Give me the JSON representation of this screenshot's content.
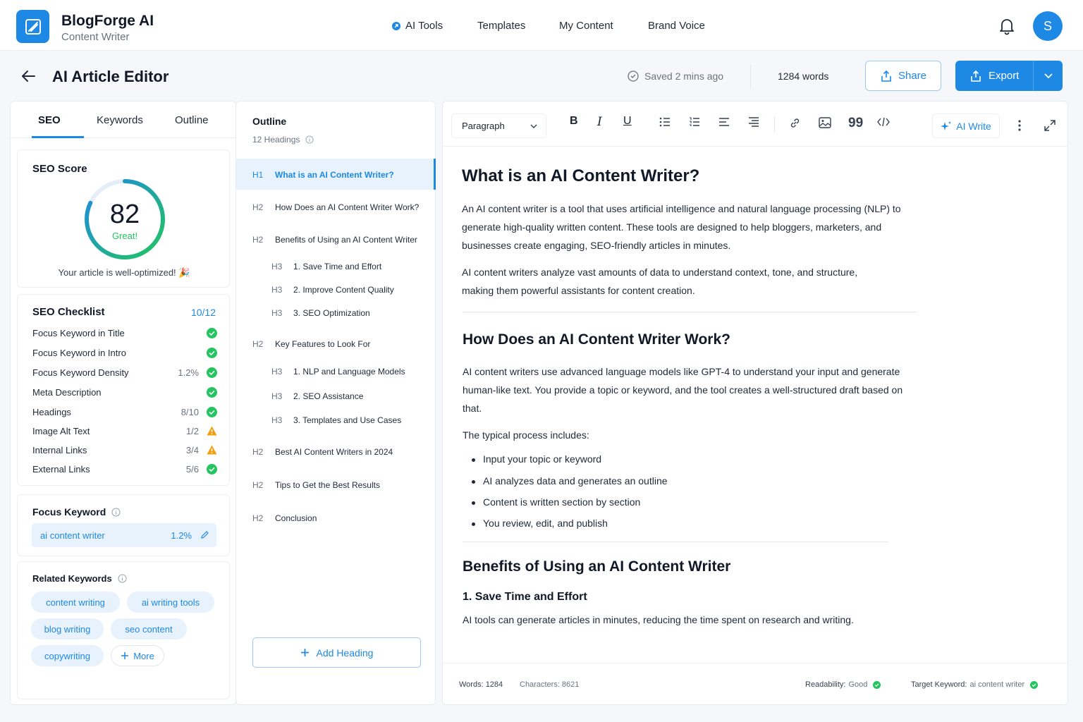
{
  "header": {
    "brand_name": "BlogForge AI",
    "brand_sub": "Content Writer",
    "nav": [
      "AI Tools",
      "Templates",
      "My Content",
      "Brand Voice"
    ],
    "avatar_initial": "S"
  },
  "page": {
    "title": "AI Article Editor",
    "saved": "Saved 2 mins ago",
    "words": "1284 words",
    "share": "Share",
    "export": "Export"
  },
  "left": {
    "tabs": [
      "SEO",
      "Keywords",
      "Outline"
    ],
    "seo_score": {
      "title": "SEO Score",
      "score": "82",
      "score_fraction": 0.82,
      "rating": "Great!",
      "message": "Your article is well-optimized! 🎉"
    },
    "checklist": {
      "title": "SEO Checklist",
      "count": "10/12",
      "items": [
        {
          "label": "Focus Keyword in Title",
          "value": "",
          "status": "ok"
        },
        {
          "label": "Focus Keyword in Intro",
          "value": "",
          "status": "ok"
        },
        {
          "label": "Focus Keyword Density",
          "value": "1.2%",
          "status": "ok"
        },
        {
          "label": "Meta Description",
          "value": "",
          "status": "ok"
        },
        {
          "label": "Headings",
          "value": "8/10",
          "status": "ok"
        },
        {
          "label": "Image Alt Text",
          "value": "1/2",
          "status": "warn"
        },
        {
          "label": "Internal Links",
          "value": "3/4",
          "status": "warn"
        },
        {
          "label": "External Links",
          "value": "5/6",
          "status": "ok"
        }
      ]
    },
    "focus_keyword": {
      "title": "Focus Keyword",
      "keyword": "ai content writer",
      "density": "1.2%"
    },
    "related": {
      "title": "Related Keywords",
      "chips": [
        "content writing",
        "ai writing tools",
        "blog writing",
        "seo content",
        "copywriting"
      ],
      "more": "More"
    }
  },
  "outline": {
    "title": "Outline",
    "count": "12 Headings",
    "items": [
      {
        "level": "H1",
        "text": "What is an AI Content Writer?"
      },
      {
        "level": "H2",
        "text": "How Does an AI Content Writer Work?"
      },
      {
        "level": "H2",
        "text": "Benefits of Using an AI Content Writer"
      },
      {
        "level": "H3",
        "text": "1. Save Time and Effort"
      },
      {
        "level": "H3",
        "text": "2. Improve Content Quality"
      },
      {
        "level": "H3",
        "text": "3. SEO Optimization"
      },
      {
        "level": "H2",
        "text": "Key Features to Look For"
      },
      {
        "level": "H3",
        "text": "1. NLP and Language Models"
      },
      {
        "level": "H3",
        "text": "2. SEO Assistance"
      },
      {
        "level": "H3",
        "text": "3. Templates and Use Cases"
      },
      {
        "level": "H2",
        "text": "Best AI Content Writers in 2024"
      },
      {
        "level": "H2",
        "text": "Tips to Get the Best Results"
      },
      {
        "level": "H2",
        "text": "Conclusion"
      }
    ],
    "add_heading": "Add Heading"
  },
  "editor": {
    "paragraph_select": "Paragraph",
    "ai_write": "AI Write",
    "h1": "What is an AI Content Writer?",
    "p1": "An AI content writer is a tool that uses artificial intelligence and natural language processing (NLP) to generate high-quality written content. These tools are designed to help bloggers, marketers, and businesses create engaging, SEO-friendly articles in minutes.",
    "p2": "AI content writers analyze vast amounts of data to understand context, tone, and structure, making them powerful assistants for content creation.",
    "h2a": "How Does an AI Content Writer Work?",
    "p3": "AI content writers use advanced language models like GPT-4 to understand your input and generate human-like text. You provide a topic or keyword, and the tool creates a well-structured draft based on that.",
    "p4": "The typical process includes:",
    "bullets": [
      "Input your topic or keyword",
      "AI analyzes data and generates an outline",
      "Content is written section by section",
      "You review, edit, and publish"
    ],
    "h2b": "Benefits of Using an AI Content Writer",
    "h3a": "1. Save Time and Effort",
    "p5": "AI tools can generate articles in minutes, reducing the time spent on research and writing.",
    "footer": {
      "words": "Words: 1284",
      "characters": "Characters: 8621",
      "readability_label": "Readability:",
      "readability_value": "Good",
      "target_label": "Target Keyword:",
      "target_value": "ai content writer"
    }
  },
  "colors": {
    "accent": "#1e88e5",
    "success": "#22c55e",
    "warning": "#f59e0b"
  }
}
